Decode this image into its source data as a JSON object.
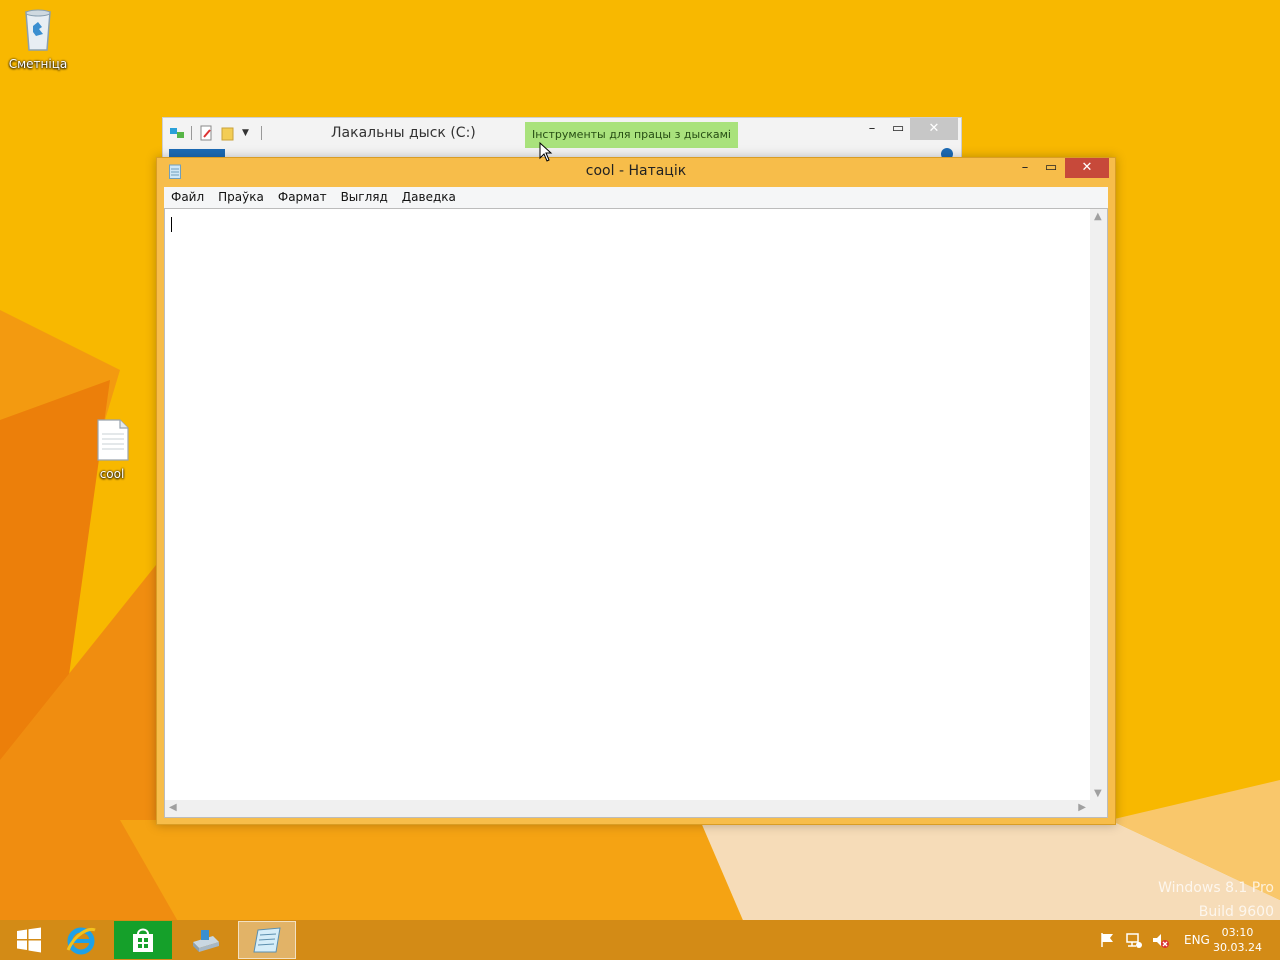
{
  "desktop": {
    "icons": [
      {
        "label": "Сметніца"
      },
      {
        "label": "cool"
      }
    ],
    "watermark": {
      "line1": "Windows 8.1 Pro",
      "line2": "Build 9600"
    }
  },
  "explorer": {
    "title": "Лакальны дыск (C:)",
    "contextual_tab": "Інструменты для працы з дыскамі"
  },
  "notepad": {
    "title": "cool - Натацік",
    "menu": [
      "Файл",
      "Праўка",
      "Фармат",
      "Выгляд",
      "Даведка"
    ],
    "content": ""
  },
  "taskbar": {
    "language": "ENG",
    "time": "03:10",
    "date": "30.03.24"
  },
  "colors": {
    "accent": "#f7b500",
    "taskbar": "#d38b16",
    "notepad_frame": "#f7bd4a",
    "close_button": "#c7493a",
    "disk_tools_tab": "#a9e27c"
  }
}
